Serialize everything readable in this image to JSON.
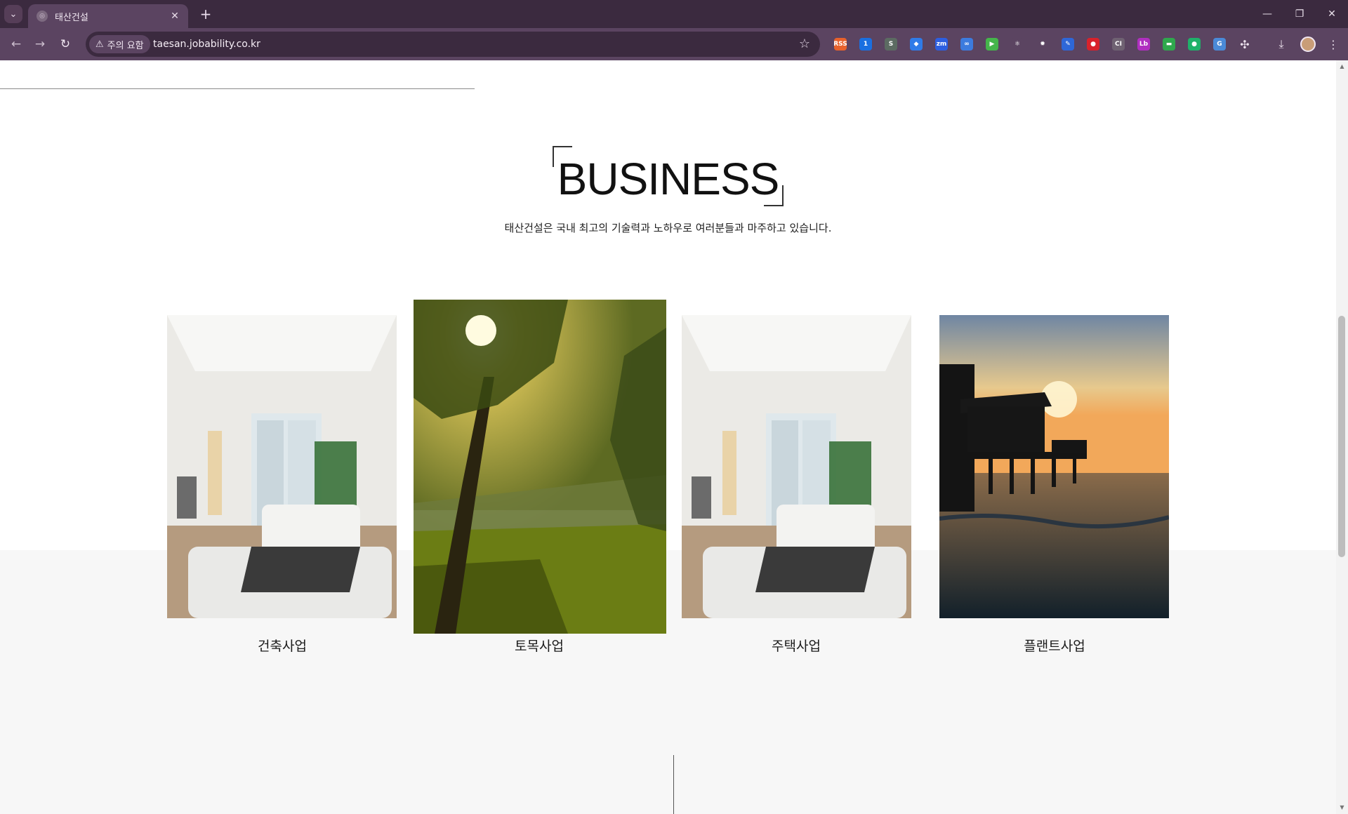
{
  "browser": {
    "tab_title": "태산건설",
    "security_label": "주의 요함",
    "url": "taesan.jobability.co.kr",
    "extensions": [
      {
        "name": "rss-extension-icon",
        "label": "RSS",
        "color": "#e8622c"
      },
      {
        "name": "onepassword-extension-icon",
        "label": "1",
        "color": "#1a6fe0"
      },
      {
        "name": "s-extension-icon",
        "label": "S",
        "color": "#5c6b62"
      },
      {
        "name": "drop-extension-icon",
        "label": "◆",
        "color": "#2f7be8"
      },
      {
        "name": "zoom-extension-icon",
        "label": "zm",
        "color": "#2d5fe0"
      },
      {
        "name": "link-extension-icon",
        "label": "∞",
        "color": "#3c7bde"
      },
      {
        "name": "play-extension-icon",
        "label": "▶",
        "color": "#45b54b"
      },
      {
        "name": "react-extension-icon",
        "label": "⚛",
        "color": "#5b4461"
      },
      {
        "name": "gear-extension-icon",
        "label": "✹",
        "color": "#5b4461"
      },
      {
        "name": "pen-extension-icon",
        "label": "✎",
        "color": "#2e67d8"
      },
      {
        "name": "record-extension-icon",
        "label": "●",
        "color": "#d8222b"
      },
      {
        "name": "ci-extension-icon",
        "label": "CI",
        "color": "#6f6272"
      },
      {
        "name": "lb-extension-icon",
        "label": "Lb",
        "color": "#b02fc0"
      },
      {
        "name": "green-card-extension-icon",
        "label": "▬",
        "color": "#2fa84d"
      },
      {
        "name": "chat-extension-icon",
        "label": "●",
        "color": "#1fb16a"
      },
      {
        "name": "translate-extension-icon",
        "label": "G",
        "color": "#4a8ad8"
      }
    ]
  },
  "business": {
    "title": "BUSINESS",
    "subtitle": "태산건설은 국내 최고의 기술력과 노하우로 여러분들과 마주하고 있습니다.",
    "cards": [
      {
        "label": "건축사업",
        "image": "interior-living-room"
      },
      {
        "label": "토목사업",
        "image": "forest-sunlight-lake"
      },
      {
        "label": "주택사업",
        "image": "interior-living-room"
      },
      {
        "label": "플랜트사업",
        "image": "pier-sunset-sea"
      }
    ]
  }
}
